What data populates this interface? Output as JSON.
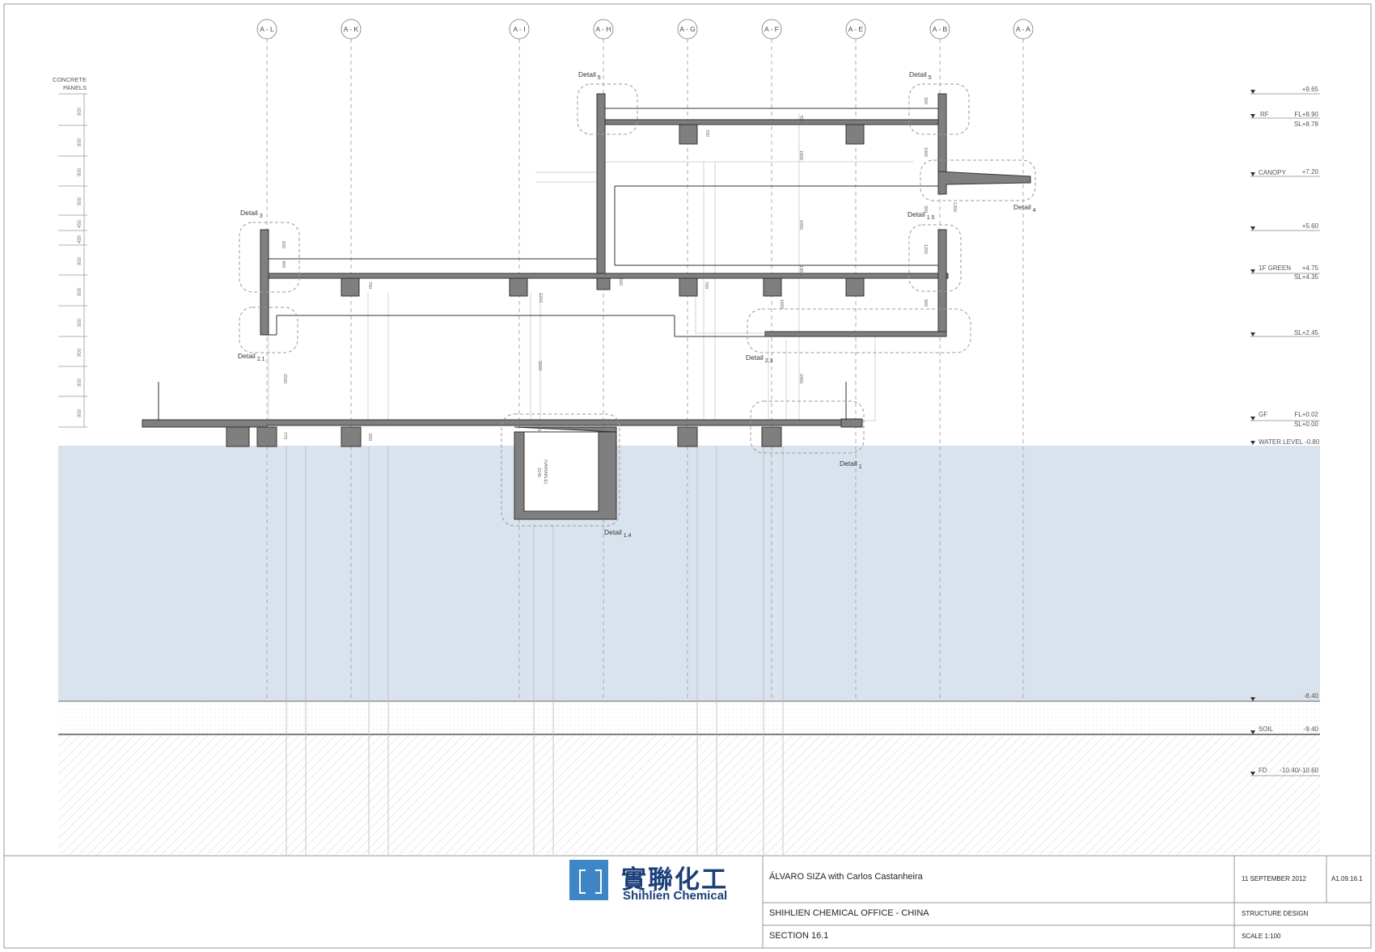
{
  "grid_axes": [
    "A - L",
    "A - K",
    "A - I",
    "A - H",
    "A - G",
    "A - F",
    "A - E",
    "A - B",
    "A - A"
  ],
  "concrete_panels": {
    "title_line1": "CONCRETE",
    "title_line2": "PANELS",
    "dims": [
      "900",
      "900",
      "900",
      "900",
      "450",
      "450",
      "900",
      "900",
      "900",
      "900",
      "900",
      "900",
      "900"
    ]
  },
  "levels": [
    {
      "name": "",
      "value": "+9.65"
    },
    {
      "name": "RF",
      "value": "FL+8.90",
      "value2": "SL+8.78"
    },
    {
      "name": "CANOPY",
      "value": "+7.20"
    },
    {
      "name": "",
      "value": "+5.60"
    },
    {
      "name": "1F GREEN",
      "value": "+4.75",
      "value2": "SL+4.35"
    },
    {
      "name": "",
      "value": "SL+2.45"
    },
    {
      "name": "GF",
      "value": "FL+0.02",
      "value2": "SL+0.00"
    },
    {
      "name": "WATER LEVEL -0.80",
      "value": ""
    },
    {
      "name": "",
      "value": "-8.40"
    },
    {
      "name": "SOIL",
      "value": "-9.40"
    },
    {
      "name": "FD",
      "value": "-10.40/-10.60"
    }
  ],
  "details": [
    {
      "label": "Detail",
      "num": "5"
    },
    {
      "label": "Detail",
      "num": "5"
    },
    {
      "label": "Detail",
      "num": "3"
    },
    {
      "label": "Detail",
      "num": "4"
    },
    {
      "label": "Detail",
      "num": "1.5"
    },
    {
      "label": "Detail",
      "num": "2.1"
    },
    {
      "label": "Detail",
      "num": "2.3"
    },
    {
      "label": "Detail",
      "num": "1"
    },
    {
      "label": "Detail",
      "num": "1.4"
    }
  ],
  "dimensions": [
    "700",
    "700",
    "1800",
    "1900",
    "300",
    "2450",
    "1300",
    "600",
    "400",
    "700",
    "500",
    "700",
    "1250",
    "1210",
    "1660",
    "900",
    "1900",
    "300",
    "2500",
    "3000",
    "2450",
    "775",
    "600",
    "2245",
    "(VARIABLE)",
    "600"
  ],
  "logo": {
    "chinese": "實聯化工",
    "english": "Shihlien Chemical",
    "brand_color": "#3f86c6",
    "text_color": "#1c3f7a"
  },
  "title_block": {
    "architect": "ÁLVARO SIZA with Carlos Castanheira",
    "date": "11 SEPTEMBER 2012",
    "sheet_no": "A1.09.16.1",
    "project": "SHIHLIEN CHEMICAL OFFICE - CHINA",
    "discipline": "STRUCTURE DESIGN",
    "drawing": "SECTION 16.1",
    "scale": "SCALE 1:100"
  },
  "colors": {
    "water": "#d9e3ee",
    "concrete": "#7f7f7f",
    "line": "#444444"
  }
}
